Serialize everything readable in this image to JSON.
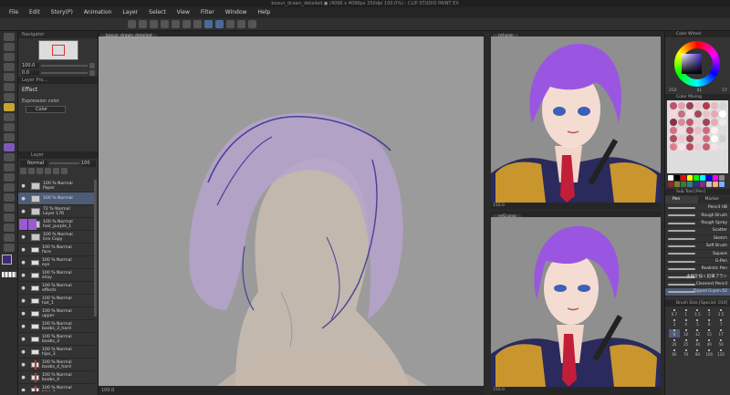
{
  "window": {
    "title": "bosun_drawn_detailed ● (4096 x 4096px 350dpi 100.0%) - CLIP STUDIO PAINT EX"
  },
  "menu": [
    "File",
    "Edit",
    "Story(P)",
    "Animation",
    "Layer",
    "Select",
    "View",
    "Filter",
    "Window",
    "Help"
  ],
  "navigator": {
    "tab_label": "Navigator",
    "zoom": "100.0",
    "angle": "0.0"
  },
  "tool_property": {
    "tab_label": "Layer Pro...",
    "effect_label": "Effect",
    "expression_color_label": "Expression color",
    "expression_color_value": "Color"
  },
  "layer_panel": {
    "tab_label": "Layer",
    "blend_mode": "Normal",
    "opacity": "100",
    "layers": [
      {
        "line1": "100 % Normal",
        "line2": "Paper",
        "type": "layer"
      },
      {
        "line1": "100 % Normal",
        "line2": "",
        "type": "layer",
        "selected": true
      },
      {
        "line1": "72 % Normal",
        "line2": "Layer 176",
        "type": "layer"
      },
      {
        "line1": "100 % Normal",
        "line2": "hair_purple_1",
        "type": "layer"
      },
      {
        "line1": "100 % Normal",
        "line2": "line Copy",
        "type": "layer"
      },
      {
        "line1": "100 % Normal",
        "line2": "face",
        "type": "folder"
      },
      {
        "line1": "100 % Normal",
        "line2": "eye",
        "type": "folder"
      },
      {
        "line1": "100 % Normal",
        "line2": "shay",
        "type": "folder"
      },
      {
        "line1": "100 % Normal",
        "line2": "effects",
        "type": "folder"
      },
      {
        "line1": "100 % Normal",
        "line2": "hat_1",
        "type": "folder"
      },
      {
        "line1": "100 % Normal",
        "line2": "upper",
        "type": "folder"
      },
      {
        "line1": "100 % Normal",
        "line2": "boobs_3_hard",
        "type": "folder"
      },
      {
        "line1": "100 % Normal",
        "line2": "boobs_3",
        "type": "folder"
      },
      {
        "line1": "100 % Normal",
        "line2": "hips_3",
        "type": "folder"
      },
      {
        "line1": "100 % Normal",
        "line2": "boobs_4_hard",
        "type": "folder"
      },
      {
        "line1": "100 % Normal",
        "line2": "boobs_4",
        "type": "folder"
      },
      {
        "line1": "100 % Normal",
        "line2": "hips_4",
        "type": "folder"
      }
    ]
  },
  "canvas": {
    "tab_label": "bosun_drawn_detailed",
    "zoom_status": "100.0"
  },
  "subview_top": {
    "tab_label": "ref.png",
    "zoom_status": "150.0"
  },
  "subview_bottom": {
    "tab_label": "ref2.png",
    "zoom_status": "150.0"
  },
  "color_panel": {
    "tab_label": "Color Wheel",
    "values": [
      "250",
      "81",
      "57"
    ],
    "palette_tab": "Color Mixing"
  },
  "palette_colors": [
    "#c74e6a",
    "#e3a1ae",
    "#9a3d53",
    "#f2c4cc",
    "#b33a4a",
    "#e9b7bf",
    "#d4d4d4",
    "#f5d6dc",
    "#c2707f",
    "#f1e2e5",
    "#a8475a",
    "#e7c2c9",
    "#e6a9b4",
    "#ffffff",
    "#8e2f44",
    "#d88b99",
    "#c2566b",
    "#f3cfd6",
    "#9c4556",
    "#e4aab6",
    "#ebebeb",
    "#d67282",
    "#f7dbe0",
    "#b85466",
    "#e9bdc6",
    "#c96c7d",
    "#fff0f2",
    "#dddddd",
    "#b54b5e",
    "#eec7cf",
    "#a14457",
    "#f4d3d9",
    "#d06b7d",
    "#ffffff",
    "#cfcfcf",
    "#e37b8c",
    "#f9e1e5",
    "#b44d60",
    "#efc9d0",
    "#c4606f",
    "#f8dfe3",
    "#e2e2e2"
  ],
  "palette_bottom": [
    "#ffffff",
    "#000000",
    "#ff0000",
    "#ffff00",
    "#00ff00",
    "#00ffff",
    "#0000ff",
    "#ff00ff",
    "#888888",
    "#7f3030",
    "#7f7f30",
    "#307f30",
    "#307f7f",
    "#30307f",
    "#7f307f",
    "#c0c0c0",
    "#ffb080",
    "#80b0ff"
  ],
  "brush_panel": {
    "tab_label": "Sub Tool [Pen]",
    "tabs": [
      "Pen",
      "Marker"
    ],
    "brushes": [
      {
        "name": "Pencil HB"
      },
      {
        "name": "Rough Brush"
      },
      {
        "name": "Rough Spray"
      },
      {
        "name": "Scatter"
      },
      {
        "name": "Sketch"
      },
      {
        "name": "Soft Brush"
      },
      {
        "name": "Square"
      },
      {
        "name": "G-Pen"
      },
      {
        "name": "Realistic Pen"
      },
      {
        "name": "主線を描く鉛筆ブラシ"
      },
      {
        "name": "Cleanest Pencil"
      },
      {
        "name": "Tipped G-pen 02",
        "selected": true
      }
    ]
  },
  "subtool_detail": {
    "tab_label": "Brush Size [Special: 010]",
    "sizes": [
      "0.7",
      "1",
      "1.5",
      "2",
      "2.5",
      "3",
      "4",
      "5",
      "6",
      "7",
      "8",
      "10",
      "12",
      "15",
      "17",
      "20",
      "25",
      "30",
      "40",
      "50",
      "60",
      "70",
      "80",
      "100",
      "120"
    ],
    "active_index": 10
  }
}
